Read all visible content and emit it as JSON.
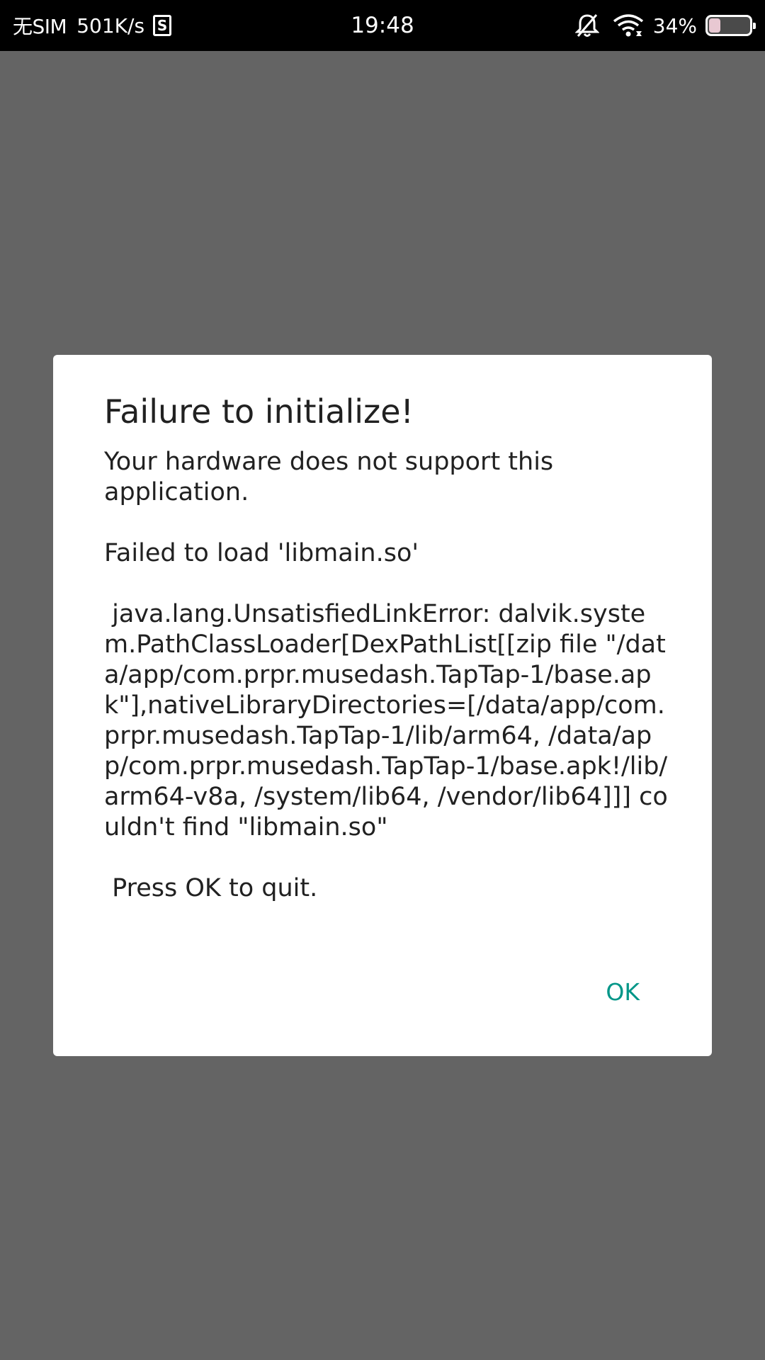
{
  "status_bar": {
    "sim": "无SIM",
    "speed": "501K/s",
    "badge": "S",
    "time": "19:48",
    "battery_percent_label": "34%",
    "battery_level": 0.34,
    "battery_fill_color": "#e8c8d2",
    "icons": [
      "s-app-icon",
      "mute-bell-icon",
      "wifi-icon",
      "battery-icon"
    ]
  },
  "dialog": {
    "title": "Failure to initialize!",
    "message_line_1": "Your hardware does not support this application.",
    "message_line_2": "Failed to load 'libmain.so'",
    "message_line_3": " java.lang.UnsatisfiedLinkError: dalvik.system.PathClassLoader[DexPathList[[zip file \"/data/app/com.prpr.musedash.TapTap-1/base.apk\"],nativeLibraryDirectories=[/data/app/com.prpr.musedash.TapTap-1/lib/arm64, /data/app/com.prpr.musedash.TapTap-1/base.apk!/lib/arm64-v8a, /system/lib64, /vendor/lib64]]] couldn't find \"libmain.so\"",
    "message_line_4": " Press OK to quit.",
    "ok_label": "OK",
    "accent_color": "#009688"
  },
  "colors": {
    "scrim": "#646464",
    "status_bar": "#000000",
    "dialog_background": "#ffffff"
  }
}
